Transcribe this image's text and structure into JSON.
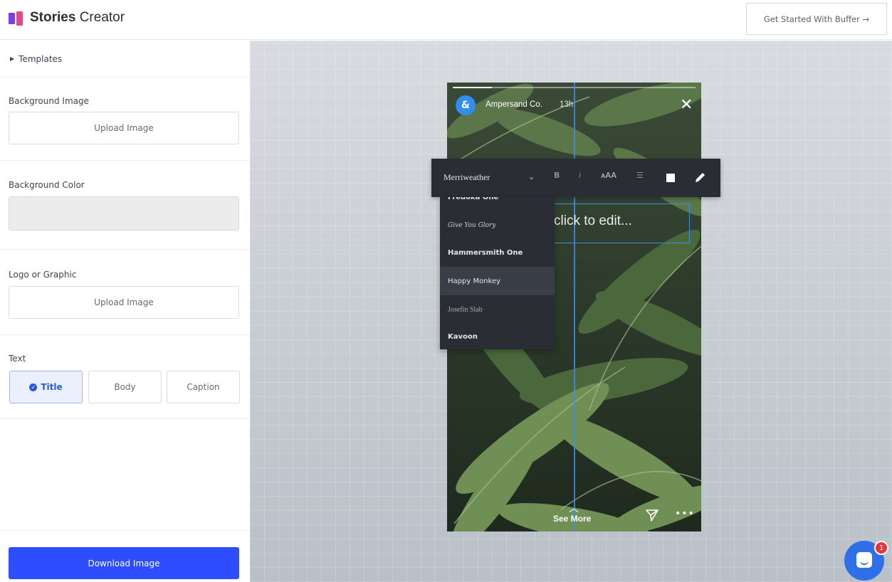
{
  "header": {
    "title_bold": "Stories",
    "title_rest": " Creator",
    "cta_label": "Get Started With Buffer →",
    "logo_colors": [
      "#7b3fe4",
      "#e8458b"
    ]
  },
  "sidebar": {
    "templates_label": "Templates",
    "background_image": {
      "label": "Background Image",
      "button": "Upload Image"
    },
    "background_color": {
      "label": "Background Color",
      "value": "#ececed"
    },
    "logo_graphic": {
      "label": "Logo or Graphic",
      "button": "Upload Image"
    },
    "text": {
      "label": "Text",
      "options": [
        {
          "label": "Title",
          "selected": true
        },
        {
          "label": "Body",
          "selected": false
        },
        {
          "label": "Caption",
          "selected": false
        }
      ]
    },
    "download_label": "Download Image"
  },
  "story": {
    "avatar_letter": "&",
    "brand_name": "Ampersand Co.",
    "time": "13h",
    "placeholder": "click to edit...",
    "see_more_arrow": "︿",
    "see_more": "See More",
    "more": "•••",
    "progress": 0.16
  },
  "toolbar": {
    "font": "Merriweather",
    "bold": "B",
    "italic": "i",
    "size": "ᴀAA",
    "align": "☰",
    "chevron": "⌄"
  },
  "font_dropdown": {
    "items": [
      {
        "label": "Fredoka One",
        "hover": false
      },
      {
        "label": "Give You Glory",
        "hover": false
      },
      {
        "label": "Hammersmith One",
        "hover": false
      },
      {
        "label": "Happy Monkey",
        "hover": true
      },
      {
        "label": "Josefin Slab",
        "hover": false
      },
      {
        "label": "Kavoon",
        "hover": false
      }
    ]
  },
  "chat": {
    "badge": "1"
  },
  "colors": {
    "accent": "#2d4dff",
    "selected_bg": "#eaf0fe",
    "guide": "#3a8fe6"
  }
}
